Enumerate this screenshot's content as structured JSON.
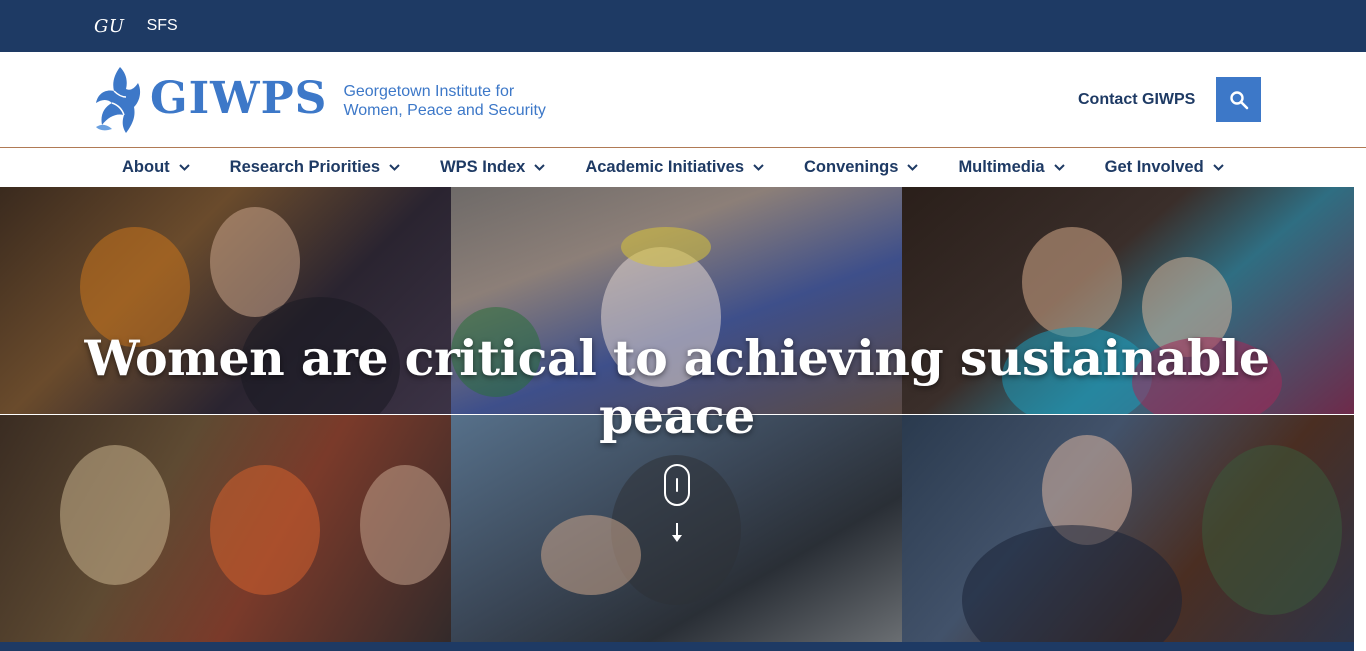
{
  "topbar": {
    "gu_label": "GU",
    "sfs_label": "SFS"
  },
  "header": {
    "logo_word": "GIWPS",
    "logo_sub_line1": "Georgetown Institute for",
    "logo_sub_line2": "Women, Peace and Security",
    "contact_label": "Contact GIWPS",
    "search_icon": "search-icon"
  },
  "nav": {
    "items": [
      {
        "label": "About"
      },
      {
        "label": "Research Priorities"
      },
      {
        "label": "WPS Index"
      },
      {
        "label": "Academic Initiatives"
      },
      {
        "label": "Convenings"
      },
      {
        "label": "Multimedia"
      },
      {
        "label": "Get Involved"
      }
    ]
  },
  "hero": {
    "title": "Women are critical to achieving sustainable peace",
    "scroll_icon": "mouse-scroll-icon"
  },
  "colors": {
    "brand_navy": "#1e3a64",
    "brand_blue": "#3d78c8",
    "rule": "#b07a55"
  }
}
